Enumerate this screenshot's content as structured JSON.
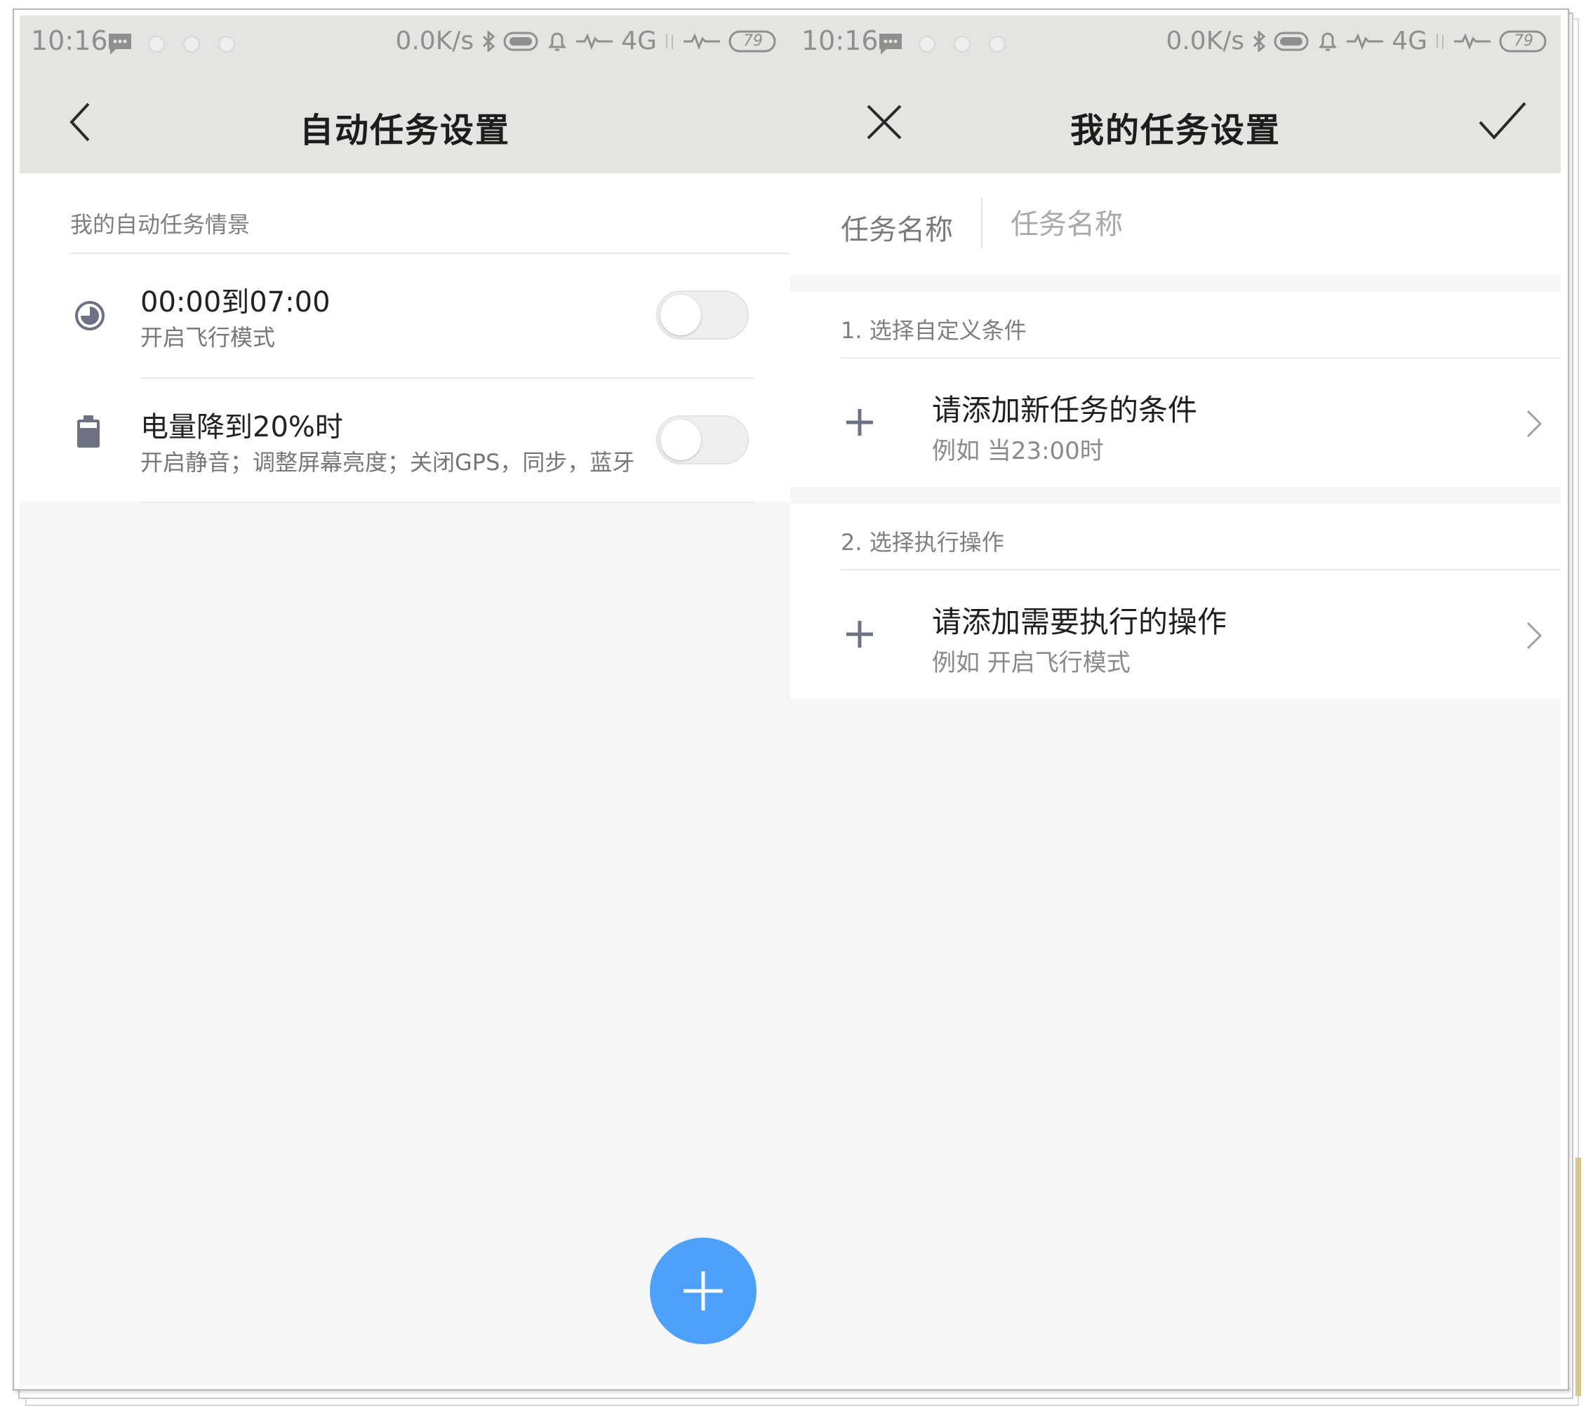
{
  "status_bar": {
    "time": "10:16",
    "net_speed": "0.0K/s",
    "network_type": "4G",
    "battery": "79",
    "icons": [
      "message-icon",
      "notification-dot-icon",
      "notification-dot-icon",
      "notification-dot-icon",
      "bluetooth-icon",
      "battery-saver-icon",
      "alarm-bell-icon",
      "signal-wave-icon",
      "data-arrows-icon",
      "signal-wave-icon",
      "battery-icon"
    ]
  },
  "left_screen": {
    "title": "自动任务设置",
    "back_icon": "chevron-left-icon",
    "section_label": "我的自动任务情景",
    "tasks": [
      {
        "icon": "clock-icon",
        "title": "00:00到07:00",
        "subtitle": "开启飞行模式",
        "enabled": false
      },
      {
        "icon": "battery-icon",
        "title": "电量降到20%时",
        "subtitle": "开启静音；调整屏幕亮度；关闭GPS，同步，蓝牙",
        "enabled": false
      }
    ],
    "fab_icon": "plus-icon"
  },
  "right_screen": {
    "title": "我的任务设置",
    "close_icon": "close-icon",
    "confirm_icon": "check-icon",
    "name_field": {
      "label": "任务名称",
      "placeholder": "任务名称",
      "value": ""
    },
    "sections": [
      {
        "header": "1. 选择自定义条件",
        "item_title": "请添加新任务的条件",
        "item_subtitle": "例如 当23:00时"
      },
      {
        "header": "2. 选择执行操作",
        "item_title": "请添加需要执行的操作",
        "item_subtitle": "例如 开启飞行模式"
      }
    ]
  },
  "colors": {
    "header_bg": "#e4e4e3",
    "page_bg": "#f6f6f6",
    "fab": "#4ea1f8",
    "icon_gray": "#6e7184"
  }
}
